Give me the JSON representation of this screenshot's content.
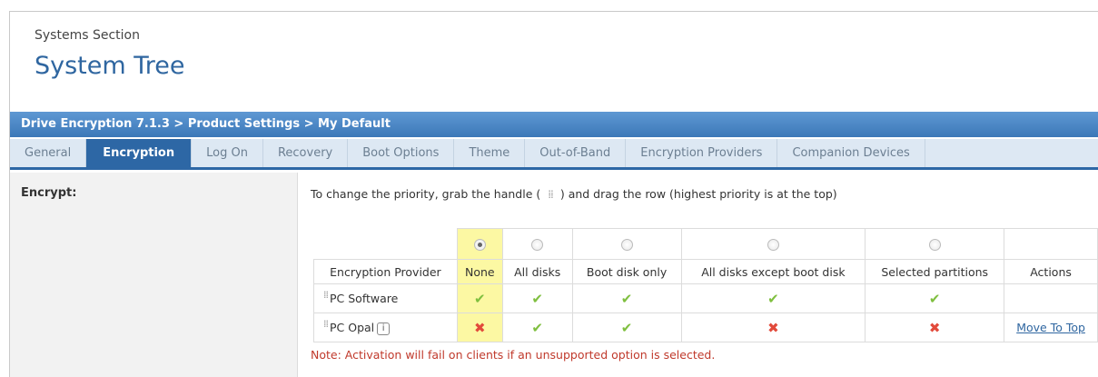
{
  "header": {
    "section": "Systems Section",
    "title": "System Tree"
  },
  "policy_path": "Drive Encryption 7.1.3 > Product Settings > My Default",
  "tabs": [
    {
      "label": "General",
      "active": false
    },
    {
      "label": "Encryption",
      "active": true
    },
    {
      "label": "Log On",
      "active": false
    },
    {
      "label": "Recovery",
      "active": false
    },
    {
      "label": "Boot Options",
      "active": false
    },
    {
      "label": "Theme",
      "active": false
    },
    {
      "label": "Out-of-Band",
      "active": false
    },
    {
      "label": "Encryption Providers",
      "active": false
    },
    {
      "label": "Companion Devices",
      "active": false
    }
  ],
  "field_label": "Encrypt:",
  "instruction": {
    "before": "To change the priority, grab the handle (",
    "handle_glyph": "⁞⁞",
    "after": ") and drag the row (highest priority is at the top)"
  },
  "table": {
    "columns": {
      "provider": "Encryption Provider",
      "none": "None",
      "all_disks": "All disks",
      "boot_disk_only": "Boot disk only",
      "all_except_boot": "All disks except boot disk",
      "selected_partitions": "Selected partitions",
      "actions": "Actions"
    },
    "selected_option": "None",
    "rows": [
      {
        "provider": "PC Software",
        "none": "check",
        "all_disks": "check",
        "boot_disk_only": "check",
        "all_except_boot": "check",
        "selected_partitions": "check",
        "action": ""
      },
      {
        "provider": "PC Opal",
        "none": "cross",
        "all_disks": "check",
        "boot_disk_only": "check",
        "all_except_boot": "cross",
        "selected_partitions": "cross",
        "action": "Move To Top"
      }
    ]
  },
  "note": "Note: Activation will fail on clients if an unsupported option is selected.",
  "icons": {
    "check": "✔",
    "cross": "✖",
    "info": "i",
    "drag": "⁞⁞"
  },
  "colors": {
    "title": "#2f66a0",
    "tab_active": "#2d67a5",
    "check": "#7fbf3f",
    "cross": "#e24a3b",
    "selected_column": "#fcf8a3",
    "note": "#c0392b"
  }
}
